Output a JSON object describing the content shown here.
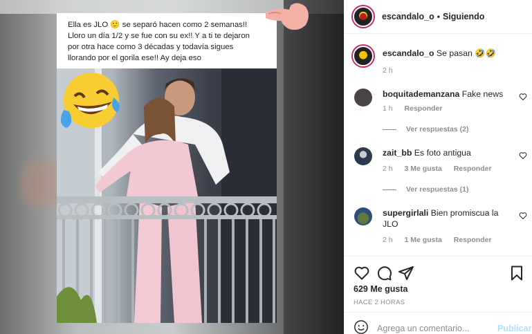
{
  "post": {
    "caption_lines": [
      "Ella es JLO 🙂 se separó hacen como 2 semanas!!",
      "Lloro un día 1/2 y se fue con su ex!! Y a ti te dejaron",
      "por otra hace como 3 décadas y todavía sigues",
      "llorando por el gorila ese!! Ay deja eso"
    ]
  },
  "header": {
    "username": "escandalo_o",
    "separator": "•",
    "follow_status": "Siguiendo"
  },
  "comments": [
    {
      "username": "escandalo_o",
      "text": "Se pasan 🤣🤣",
      "time": "2 h",
      "likes": "",
      "reply": "",
      "view_replies": "",
      "avatar_color": "#222222"
    },
    {
      "username": "boquitademanzana",
      "text": "Fake news",
      "time": "1 h",
      "likes": "",
      "reply": "Responder",
      "view_replies": "Ver respuestas (2)",
      "avatar_color": "#4a4444"
    },
    {
      "username": "zait_bb",
      "text": "Es foto antigua",
      "time": "2 h",
      "likes": "3 Me gusta",
      "reply": "Responder",
      "view_replies": "Ver respuestas (1)",
      "avatar_color": "#2c3a4e"
    },
    {
      "username": "supergirlali",
      "text": "Bien promiscua la JLO",
      "time": "2 h",
      "likes": "1 Me gusta",
      "reply": "Responder",
      "view_replies": "",
      "avatar_color": "#5f7a3a"
    }
  ],
  "actions": {
    "likes": "629 Me gusta",
    "time_ago": "HACE 2 HORAS"
  },
  "add_comment": {
    "placeholder": "Agrega un comentario...",
    "publish": "Publicar"
  },
  "colors": {
    "accent_disabled": "#b2dffc",
    "muted": "#8e8e8e",
    "text": "#262626",
    "border": "#efefef"
  }
}
